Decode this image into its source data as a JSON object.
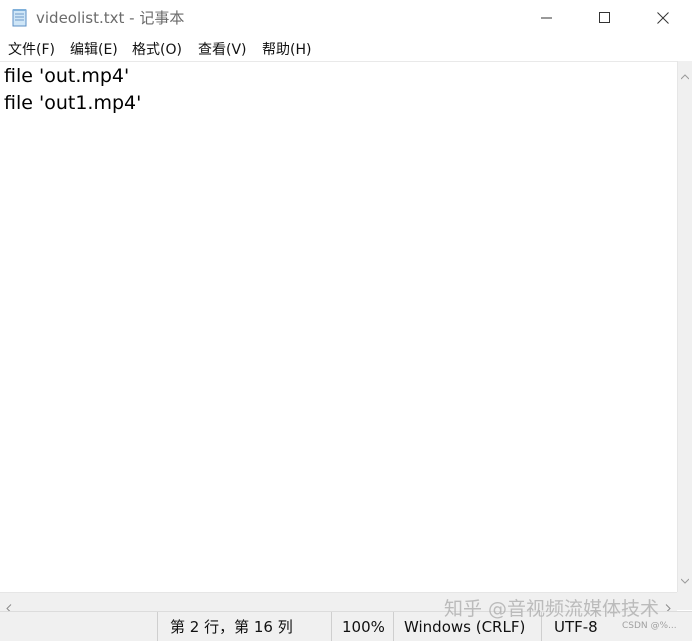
{
  "window": {
    "title": "videolist.txt - 记事本"
  },
  "menu": [
    {
      "label": "文件(F)"
    },
    {
      "label": "编辑(E)"
    },
    {
      "label": "格式(O)"
    },
    {
      "label": "查看(V)"
    },
    {
      "label": "帮助(H)"
    }
  ],
  "editor": {
    "lines": [
      "file 'out.mp4'",
      "file 'out1.mp4'"
    ]
  },
  "status": {
    "position": "第 2 行，第 16 列",
    "zoom": "100%",
    "line_ending": "Windows (CRLF)",
    "encoding": "UTF-8"
  },
  "watermark": {
    "text": "知乎 @音视频流媒体技术",
    "small": "CSDN @%..."
  },
  "icons": {
    "app": "notepad-icon",
    "minimize": "minimize-icon",
    "maximize": "maximize-icon",
    "close": "close-icon",
    "scroll_left": "chevron-left-icon",
    "scroll_right": "chevron-right-icon"
  }
}
